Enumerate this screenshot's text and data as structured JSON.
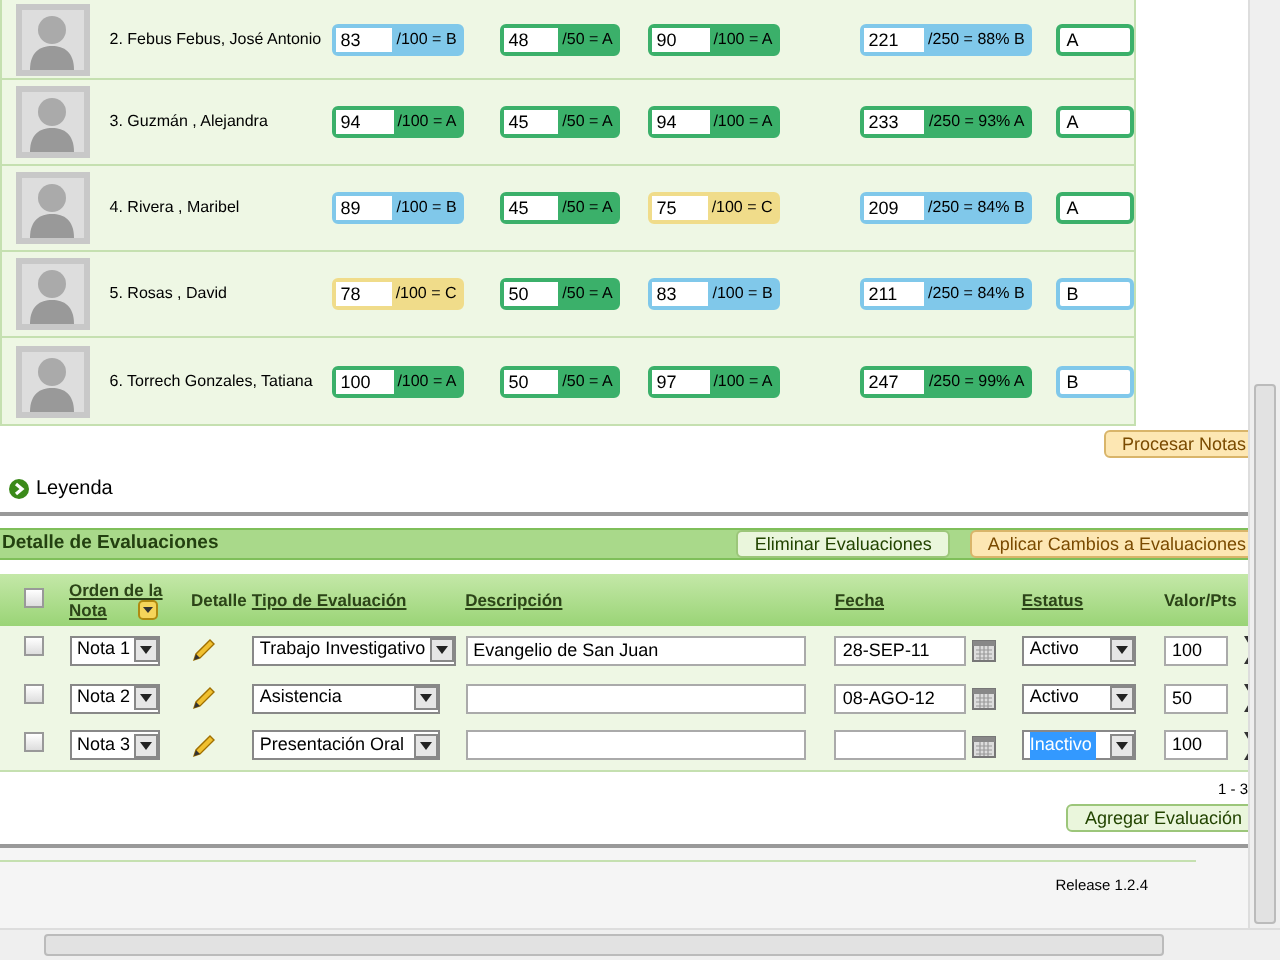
{
  "students": [
    {
      "name": "2. Febus Febus, José Antonio",
      "grades": [
        {
          "value": "83",
          "suffix": "/100 = B",
          "color": "#80c8ea"
        },
        {
          "value": "48",
          "suffix": "/50 = A",
          "color": "#3bb06a"
        },
        {
          "value": "90",
          "suffix": "/100 = A",
          "color": "#3bb06a"
        }
      ],
      "total": {
        "value": "221",
        "suffix": "/250 = 88% B",
        "color": "#80c8ea"
      },
      "final": {
        "value": "A",
        "color": "#3bb06a"
      }
    },
    {
      "name": "3. Guzmán , Alejandra",
      "grades": [
        {
          "value": "94",
          "suffix": "/100 = A",
          "color": "#3bb06a"
        },
        {
          "value": "45",
          "suffix": "/50 = A",
          "color": "#3bb06a"
        },
        {
          "value": "94",
          "suffix": "/100 = A",
          "color": "#3bb06a"
        }
      ],
      "total": {
        "value": "233",
        "suffix": "/250 = 93% A",
        "color": "#3bb06a"
      },
      "final": {
        "value": "A",
        "color": "#3bb06a"
      }
    },
    {
      "name": "4. Rivera , Maribel",
      "grades": [
        {
          "value": "89",
          "suffix": "/100 = B",
          "color": "#80c8ea"
        },
        {
          "value": "45",
          "suffix": "/50 = A",
          "color": "#3bb06a"
        },
        {
          "value": "75",
          "suffix": "/100 = C",
          "color": "#f0dc8a"
        }
      ],
      "total": {
        "value": "209",
        "suffix": "/250 = 84% B",
        "color": "#80c8ea"
      },
      "final": {
        "value": "A",
        "color": "#3bb06a"
      }
    },
    {
      "name": "5. Rosas , David",
      "grades": [
        {
          "value": "78",
          "suffix": "/100 = C",
          "color": "#f0dc8a"
        },
        {
          "value": "50",
          "suffix": "/50 = A",
          "color": "#3bb06a"
        },
        {
          "value": "83",
          "suffix": "/100 = B",
          "color": "#80c8ea"
        }
      ],
      "total": {
        "value": "211",
        "suffix": "/250 = 84% B",
        "color": "#80c8ea"
      },
      "final": {
        "value": "B",
        "color": "#80c8ea"
      }
    },
    {
      "name": "6. Torrech Gonzales, Tatiana",
      "grades": [
        {
          "value": "100",
          "suffix": "/100 = A",
          "color": "#3bb06a"
        },
        {
          "value": "50",
          "suffix": "/50 = A",
          "color": "#3bb06a"
        },
        {
          "value": "97",
          "suffix": "/100 = A",
          "color": "#3bb06a"
        }
      ],
      "total": {
        "value": "247",
        "suffix": "/250 = 99% A",
        "color": "#3bb06a"
      },
      "final": {
        "value": "B",
        "color": "#80c8ea"
      }
    }
  ],
  "process_button": "Procesar Notas",
  "legend": {
    "label": "Leyenda",
    "expanded": false
  },
  "evaluations": {
    "title": "Detalle de Evaluaciones",
    "buttons": [
      {
        "label": "Eliminar Evaluaciones",
        "kind": "plain"
      },
      {
        "label": "Aplicar Cambios a Evaluaciones",
        "kind": "primary"
      }
    ],
    "select_all": {
      "checked": false
    },
    "columns": [
      {
        "label": "Orden de la Nota",
        "kind": "sort"
      },
      {
        "label": "Detalle",
        "kind": "plain"
      },
      {
        "label": "Tipo de Evaluación",
        "kind": "link"
      },
      {
        "label": "Descripción",
        "kind": "link"
      },
      {
        "label": "Fecha",
        "kind": "link"
      },
      {
        "label": "Estatus",
        "kind": "link"
      },
      {
        "label": "Valor/Pts",
        "kind": "plain"
      }
    ],
    "rows": [
      {
        "checked": false,
        "order": "Nota 1",
        "type": "Trabajo Investigativo",
        "description": "Evangelio de San Juan",
        "date": "28-SEP-11",
        "status": "Activo",
        "status_selected": false,
        "value": "100"
      },
      {
        "checked": false,
        "order": "Nota 2",
        "type": "Asistencia",
        "description": "",
        "date": "08-AGO-12",
        "status": "Activo",
        "status_selected": false,
        "value": "50"
      },
      {
        "checked": false,
        "order": "Nota 3",
        "type": "Presentación Oral",
        "description": "",
        "date": "",
        "status": "Inactivo",
        "status_selected": true,
        "value": "100"
      }
    ],
    "pager": "1 - 3",
    "add_button": "Agregar Evaluación"
  },
  "footer": {
    "release": "Release 1.2.4"
  }
}
